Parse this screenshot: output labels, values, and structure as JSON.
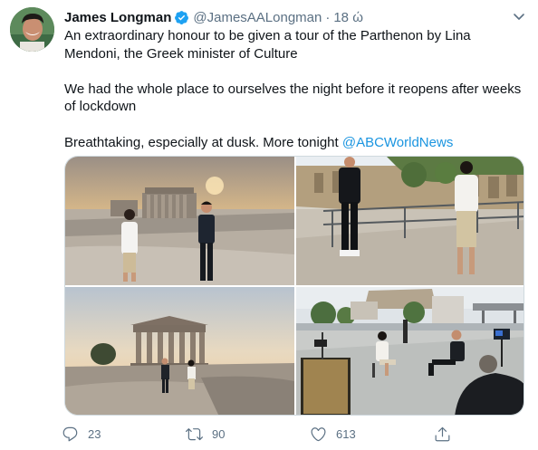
{
  "author": {
    "name": "James Longman",
    "handle": "@JamesAALongman",
    "separator": "·",
    "time": "18 ώ",
    "verified": true
  },
  "tweet": {
    "line1": "An extraordinary honour to be given a tour of the Parthenon by Lina Mendoni, the Greek minister of Culture",
    "line2": "We had the whole place to ourselves the night before it reopens after weeks of lockdown",
    "line3_text": "Breathtaking, especially at dusk. More tonight ",
    "line3_mention": "@ABCWorldNews"
  },
  "media": {
    "photos": [
      {
        "label": "parthenon-dusk-two-people"
      },
      {
        "label": "theatre-ruins-two-people"
      },
      {
        "label": "parthenon-sunset-wide"
      },
      {
        "label": "interview-setup-terrace"
      }
    ]
  },
  "actions": {
    "reply": {
      "icon": "reply-icon",
      "count": "23"
    },
    "retweet": {
      "icon": "retweet-icon",
      "count": "90"
    },
    "like": {
      "icon": "heart-icon",
      "count": "613"
    },
    "share": {
      "icon": "share-icon"
    }
  },
  "colors": {
    "accent": "#1b95e0",
    "verified": "#1da1f2",
    "muted": "#5b7083",
    "text": "#0f1419"
  }
}
